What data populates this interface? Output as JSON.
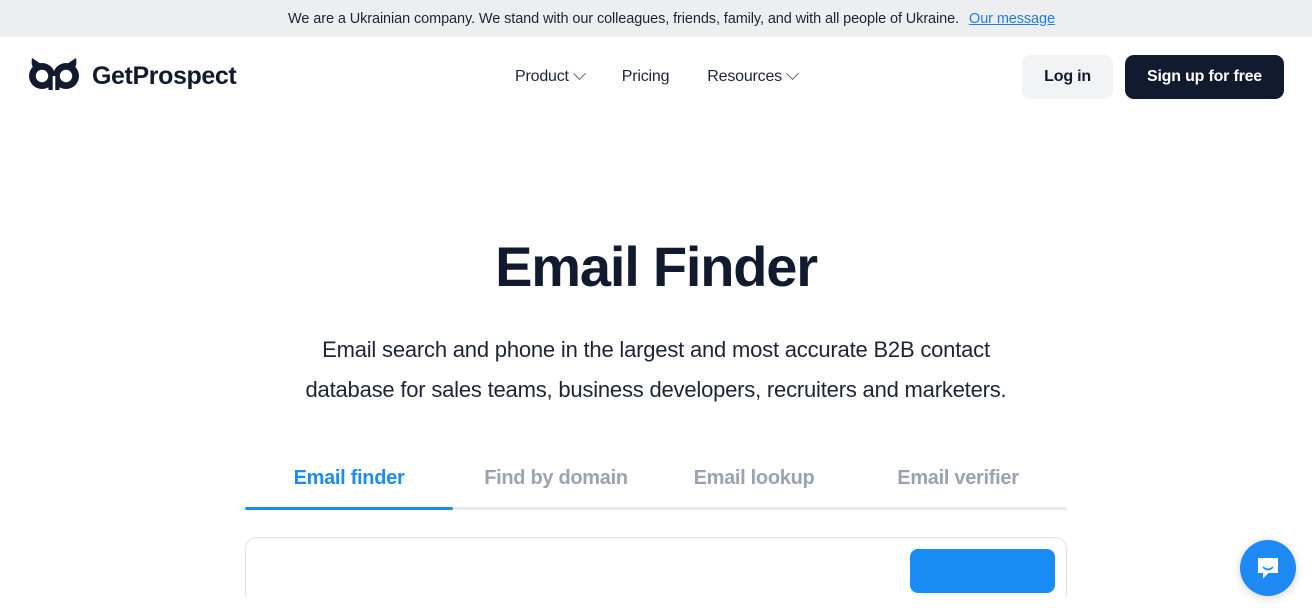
{
  "banner": {
    "flag_icon": "ukraine-flag-icon",
    "text": "We are a Ukrainian company. We stand with our colleagues, friends, family, and with all people of Ukraine.",
    "link_label": "Our message",
    "background_color": "#EDEEF0",
    "link_color": "#1A7EF0"
  },
  "header": {
    "logo_icon": "getprospect-owl-logo-icon",
    "brand": "GetProspect",
    "nav": [
      {
        "label": "Product",
        "has_dropdown": true
      },
      {
        "label": "Pricing",
        "has_dropdown": false
      },
      {
        "label": "Resources",
        "has_dropdown": true
      }
    ],
    "login_label": "Log in",
    "signup_label": "Sign up for free",
    "signup_color": "#111A2E"
  },
  "hero": {
    "title": "Email Finder",
    "subtitle": "Email search and phone in the largest and most accurate B2B contact database for sales teams, business developers, recruiters and marketers."
  },
  "tabs": {
    "items": [
      {
        "label": "Email finder",
        "active": true
      },
      {
        "label": "Find by domain",
        "active": false
      },
      {
        "label": "Email lookup",
        "active": false
      },
      {
        "label": "Email verifier",
        "active": false
      }
    ],
    "active_color": "#1A8CF5",
    "inactive_color": "#9AA3AF"
  },
  "search_card": {
    "submit_button_color": "#1A8CF5"
  },
  "chat": {
    "icon": "chat-bubble-icon",
    "color": "#1D8AF5"
  }
}
